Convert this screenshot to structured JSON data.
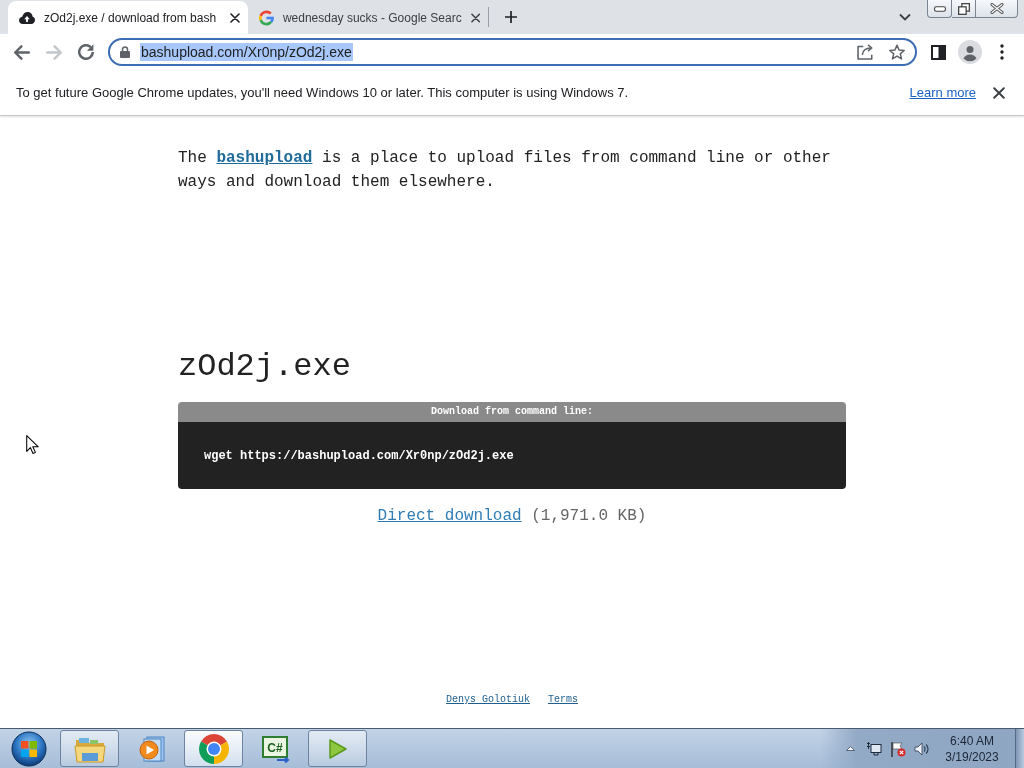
{
  "browser": {
    "tabs": [
      {
        "kind": "upload",
        "title": "zOd2j.exe / download from bash",
        "selected": true
      },
      {
        "kind": "google",
        "title": "wednesday sucks - Google Searc",
        "selected": false
      }
    ],
    "nav": [
      {
        "kind": "back",
        "disabled": false
      },
      {
        "kind": "forward",
        "disabled": true
      },
      {
        "kind": "reload",
        "disabled": false
      }
    ],
    "address": {
      "url": "bashupload.com/Xr0np/zOd2j.exe",
      "focused": true,
      "selected": true
    },
    "infobar": {
      "message": "To get future Google Chrome updates, you'll need Windows 10 or later. This computer is using Windows 7.",
      "link": "Learn more"
    }
  },
  "page": {
    "intro": {
      "before": "The ",
      "link": "bashupload",
      "after": " is a place to upload files from command line or other ways and download them elsewhere."
    },
    "file_name": "zOd2j.exe",
    "command_box": {
      "title": "Download from command line:",
      "command": "wget https://bashupload.com/Xr0np/zOd2j.exe"
    },
    "download": {
      "link": "Direct download",
      "size": "(1,971.0 KB)"
    },
    "footer_links": [
      "Denys Golotiuk",
      "Terms"
    ]
  },
  "taskbar": {
    "apps": [
      {
        "kind": "folder",
        "running": true,
        "selected": false
      },
      {
        "kind": "media",
        "running": false,
        "selected": false
      },
      {
        "kind": "browser",
        "running": true,
        "selected": true
      },
      {
        "kind": "code",
        "label": "C#",
        "running": false,
        "selected": false
      },
      {
        "kind": "play",
        "running": true,
        "selected": false
      }
    ],
    "clock": {
      "time": "6:40 AM",
      "date": "3/19/2023"
    }
  }
}
